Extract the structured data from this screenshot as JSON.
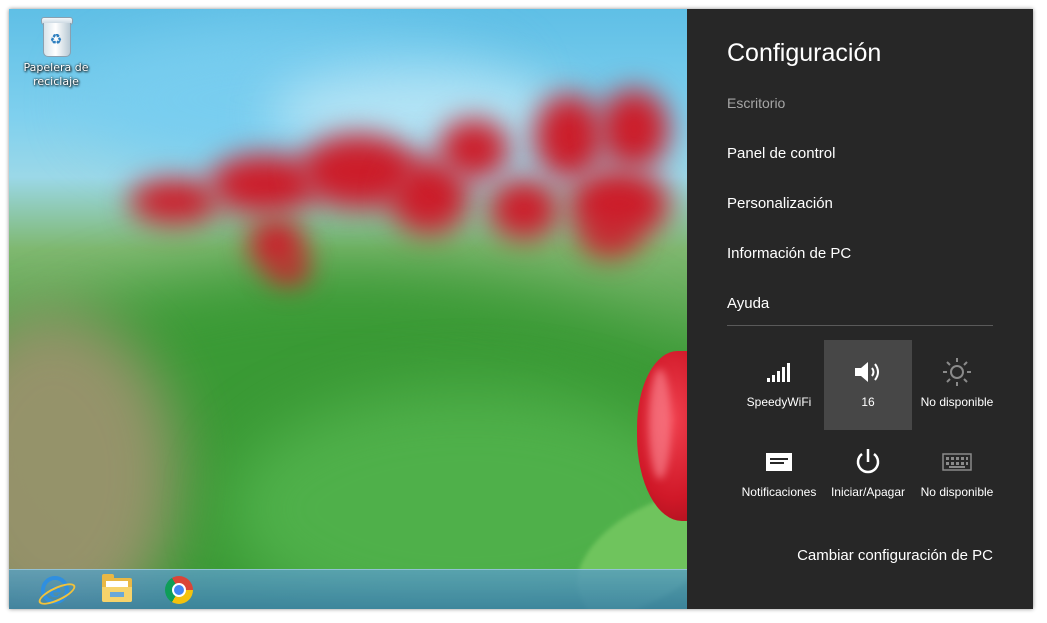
{
  "desktop": {
    "recycle_bin_label": "Papelera de reciclaje"
  },
  "taskbar": {
    "pinned": [
      {
        "icon": "internet-explorer-icon"
      },
      {
        "icon": "file-explorer-icon"
      },
      {
        "icon": "chrome-icon"
      }
    ]
  },
  "charm": {
    "title": "Configuración",
    "context": "Escritorio",
    "links": [
      "Panel de control",
      "Personalización",
      "Información de PC",
      "Ayuda"
    ],
    "quick": {
      "network_label": "SpeedyWiFi",
      "volume_label": "16",
      "brightness_label": "No disponible",
      "notifications_label": "Notificaciones",
      "power_label": "Iniciar/Apagar",
      "keyboard_label": "No disponible"
    },
    "footer_link": "Cambiar configuración de PC",
    "colors": {
      "background": "#272727",
      "active_tile": "#474747",
      "muted_text": "#a6a6a6",
      "disabled_icon": "#8a8a8a"
    }
  }
}
